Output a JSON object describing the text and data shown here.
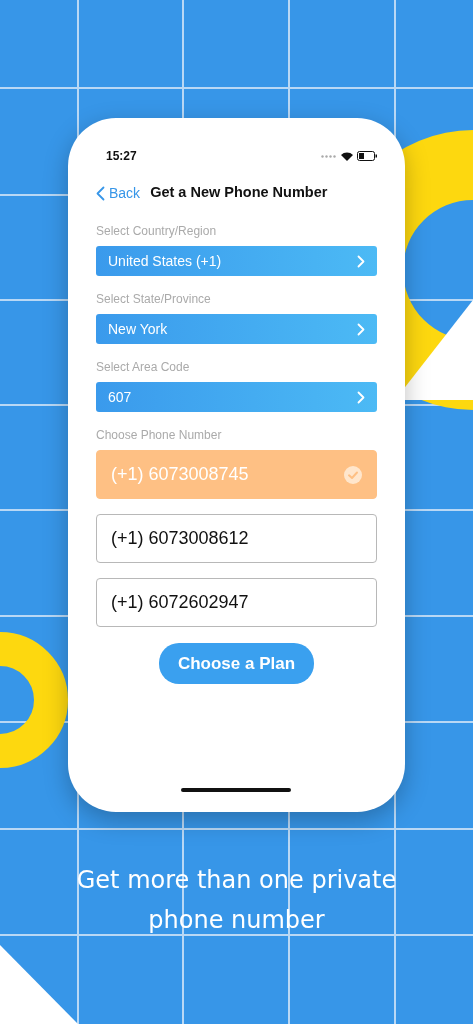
{
  "status_bar": {
    "time": "15:27"
  },
  "nav": {
    "back": "Back",
    "title": "Get a New Phone Number"
  },
  "selectors": [
    {
      "label": "Select Country/Region",
      "value": "United States (+1)"
    },
    {
      "label": "Select State/Province",
      "value": "New York"
    },
    {
      "label": "Select Area Code",
      "value": "607"
    }
  ],
  "numbers": {
    "label": "Choose Phone Number",
    "options": [
      {
        "number": "(+1) 6073008745",
        "selected": true
      },
      {
        "number": "(+1) 6073008612",
        "selected": false
      },
      {
        "number": "(+1) 6072602947",
        "selected": false
      }
    ]
  },
  "button": "Choose a Plan",
  "caption": "Get more than one private phone number"
}
